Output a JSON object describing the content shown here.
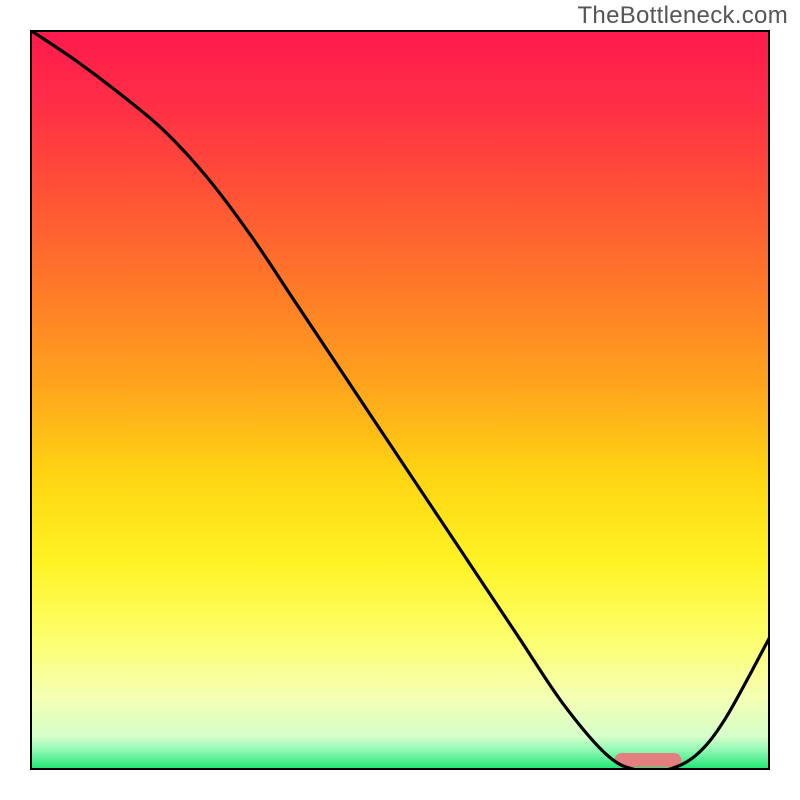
{
  "watermark": "TheBottleneck.com",
  "chart_data": {
    "type": "line",
    "title": "",
    "xlabel": "",
    "ylabel": "",
    "xlim": [
      0,
      100
    ],
    "ylim": [
      0,
      100
    ],
    "grid": false,
    "series": [
      {
        "name": "curve",
        "x": [
          0,
          6,
          12,
          18,
          24,
          30,
          36,
          42,
          48,
          54,
          60,
          66,
          72,
          78,
          82,
          86,
          90,
          94,
          100
        ],
        "y": [
          100,
          96,
          91.5,
          86.5,
          80,
          72,
          63,
          54,
          45,
          36,
          27,
          18,
          9,
          2,
          0,
          0,
          2,
          7,
          18
        ]
      }
    ],
    "highlight_bar": {
      "x_start": 79,
      "x_end": 88,
      "color": "#e37f7e"
    },
    "gradient_stops": [
      {
        "pos": 0.0,
        "color": "#ff1a4c"
      },
      {
        "pos": 0.1,
        "color": "#ff2e46"
      },
      {
        "pos": 0.22,
        "color": "#ff5236"
      },
      {
        "pos": 0.35,
        "color": "#ff7a28"
      },
      {
        "pos": 0.48,
        "color": "#ffa41c"
      },
      {
        "pos": 0.6,
        "color": "#ffd412"
      },
      {
        "pos": 0.72,
        "color": "#fff325"
      },
      {
        "pos": 0.82,
        "color": "#fdff6a"
      },
      {
        "pos": 0.9,
        "color": "#f5ffb2"
      },
      {
        "pos": 0.955,
        "color": "#d6ffca"
      },
      {
        "pos": 0.975,
        "color": "#88f7b0"
      },
      {
        "pos": 1.0,
        "color": "#18e46e"
      }
    ]
  }
}
